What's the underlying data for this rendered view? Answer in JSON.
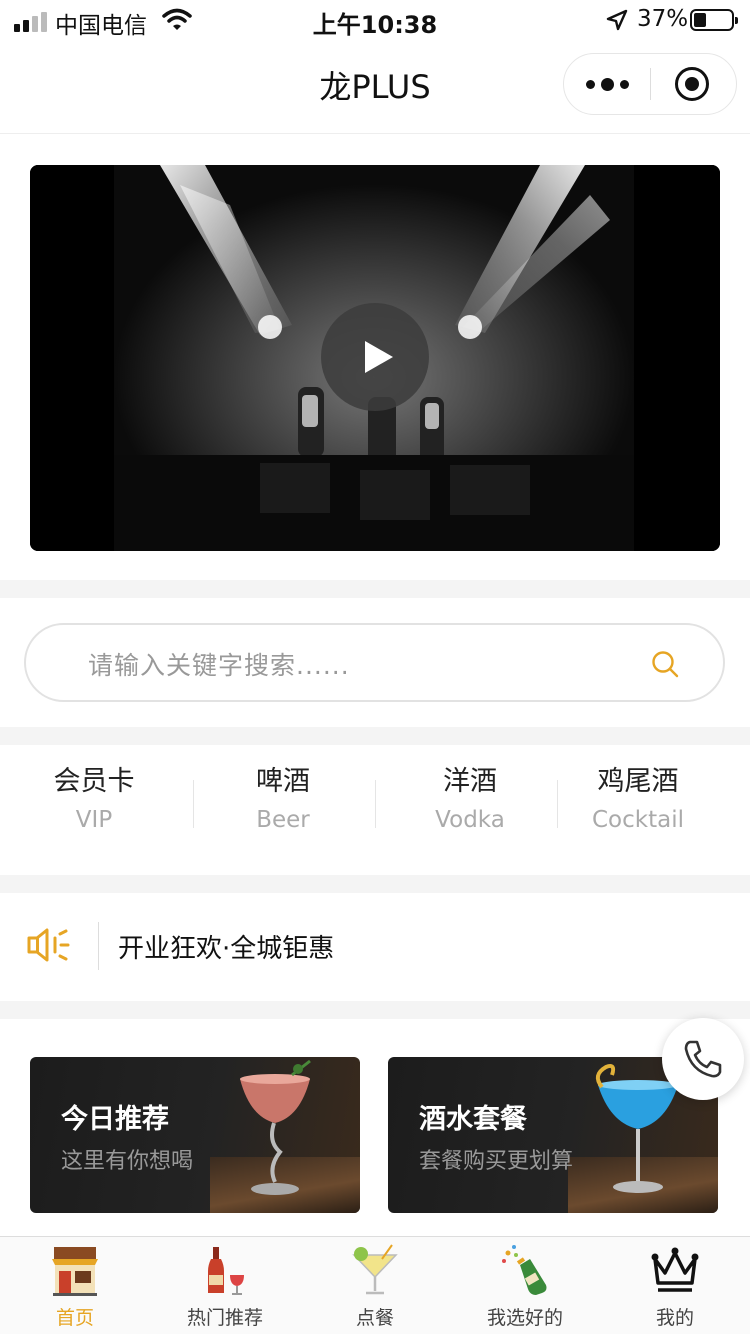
{
  "status_bar": {
    "carrier": "中国电信",
    "time": "上午10:38",
    "battery": "37%",
    "battery_level": 0.37
  },
  "nav": {
    "title": "龙PLUS"
  },
  "video": {
    "state": "paused"
  },
  "search": {
    "placeholder": "请输入关键字搜索......",
    "icon": "search-icon"
  },
  "categories": [
    {
      "name": "会员卡",
      "sub": "VIP"
    },
    {
      "name": "啤酒",
      "sub": "Beer"
    },
    {
      "name": "洋酒",
      "sub": "Vodka"
    },
    {
      "name": "鸡尾酒",
      "sub": "Cocktail"
    }
  ],
  "notice": {
    "icon": "speaker-icon",
    "text": "开业狂欢·全城钜惠"
  },
  "promos": [
    {
      "title": "今日推荐",
      "subtitle": "这里有你想喝"
    },
    {
      "title": "酒水套餐",
      "subtitle": "套餐购买更划算"
    }
  ],
  "tabs": [
    {
      "label": "首页",
      "icon": "shop-icon",
      "active": true
    },
    {
      "label": "热门推荐",
      "icon": "wine-bottle-icon",
      "active": false
    },
    {
      "label": "点餐",
      "icon": "cocktail-icon",
      "active": false
    },
    {
      "label": "我选好的",
      "icon": "champagne-icon",
      "active": false
    },
    {
      "label": "我的",
      "icon": "crown-icon",
      "active": false
    }
  ],
  "colors": {
    "accent": "#e6a524",
    "gap": "#f4f4f4"
  }
}
